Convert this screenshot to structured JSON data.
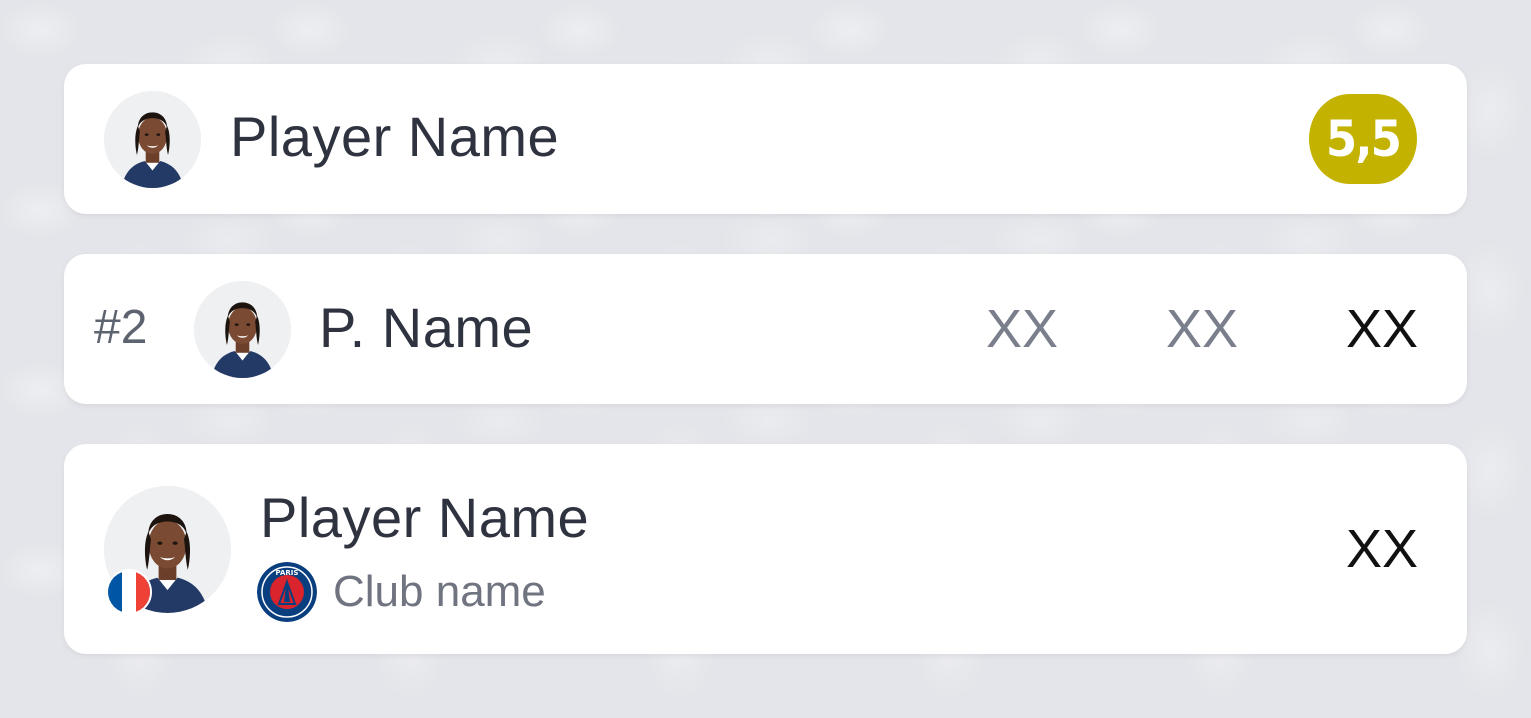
{
  "card_large": {
    "name": "Player Name",
    "rating": "5,5",
    "rating_color": "#c3b300"
  },
  "card_ranked": {
    "rank": "#2",
    "name": "P. Name",
    "stats": [
      "XX",
      "XX",
      "XX"
    ]
  },
  "card_detail": {
    "name": "Player Name",
    "club_name": "Club name",
    "club_badge_text": "PARIS",
    "flag_colors": [
      "#0055a4",
      "#ffffff",
      "#ef4135"
    ],
    "stat": "XX"
  },
  "icons": {
    "avatar": "player-avatar-icon",
    "club": "psg-badge-icon",
    "flag": "france-flag-icon"
  }
}
